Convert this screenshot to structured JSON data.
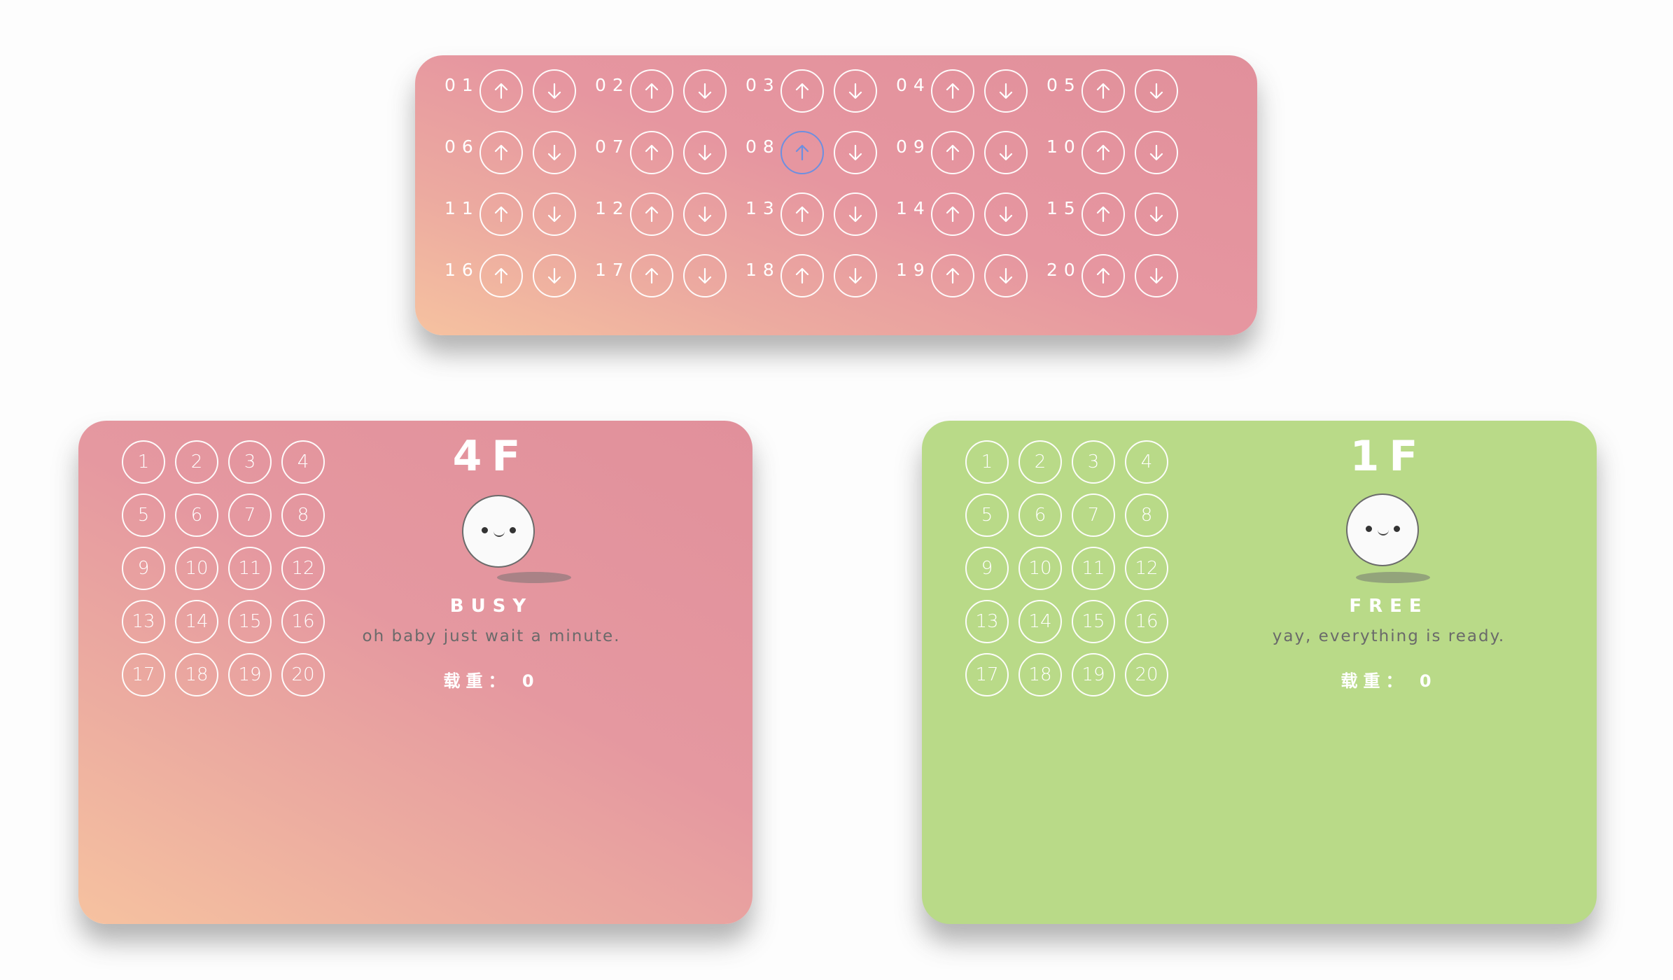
{
  "call_panel": {
    "floors": [
      {
        "label": "01",
        "up_active": false
      },
      {
        "label": "02",
        "up_active": false
      },
      {
        "label": "03",
        "up_active": false
      },
      {
        "label": "04",
        "up_active": false
      },
      {
        "label": "05",
        "up_active": false
      },
      {
        "label": "06",
        "up_active": false
      },
      {
        "label": "07",
        "up_active": false
      },
      {
        "label": "08",
        "up_active": true
      },
      {
        "label": "09",
        "up_active": false
      },
      {
        "label": "10",
        "up_active": false
      },
      {
        "label": "11",
        "up_active": false
      },
      {
        "label": "12",
        "up_active": false
      },
      {
        "label": "13",
        "up_active": false
      },
      {
        "label": "14",
        "up_active": false
      },
      {
        "label": "15",
        "up_active": false
      },
      {
        "label": "16",
        "up_active": false
      },
      {
        "label": "17",
        "up_active": false
      },
      {
        "label": "18",
        "up_active": false
      },
      {
        "label": "19",
        "up_active": false
      },
      {
        "label": "20",
        "up_active": false
      }
    ],
    "up_icon": "arrow-up-icon",
    "down_icon": "arrow-down-icon",
    "active_color": "#6d8fe0"
  },
  "elevators": [
    {
      "id": "a",
      "floor_display": "4F",
      "status": "BUSY",
      "message": "oh baby just wait a minute.",
      "load_label": "载重：",
      "load_value": "0",
      "keys": [
        "1",
        "2",
        "3",
        "4",
        "5",
        "6",
        "7",
        "8",
        "9",
        "10",
        "11",
        "12",
        "13",
        "14",
        "15",
        "16",
        "17",
        "18",
        "19",
        "20"
      ],
      "background": "gradient-peach-pink"
    },
    {
      "id": "b",
      "floor_display": "1F",
      "status": "FREE",
      "message": "yay, everything is ready.",
      "load_label": "载重：",
      "load_value": "0",
      "keys": [
        "1",
        "2",
        "3",
        "4",
        "5",
        "6",
        "7",
        "8",
        "9",
        "10",
        "11",
        "12",
        "13",
        "14",
        "15",
        "16",
        "17",
        "18",
        "19",
        "20"
      ],
      "background": "#b9da88"
    }
  ]
}
